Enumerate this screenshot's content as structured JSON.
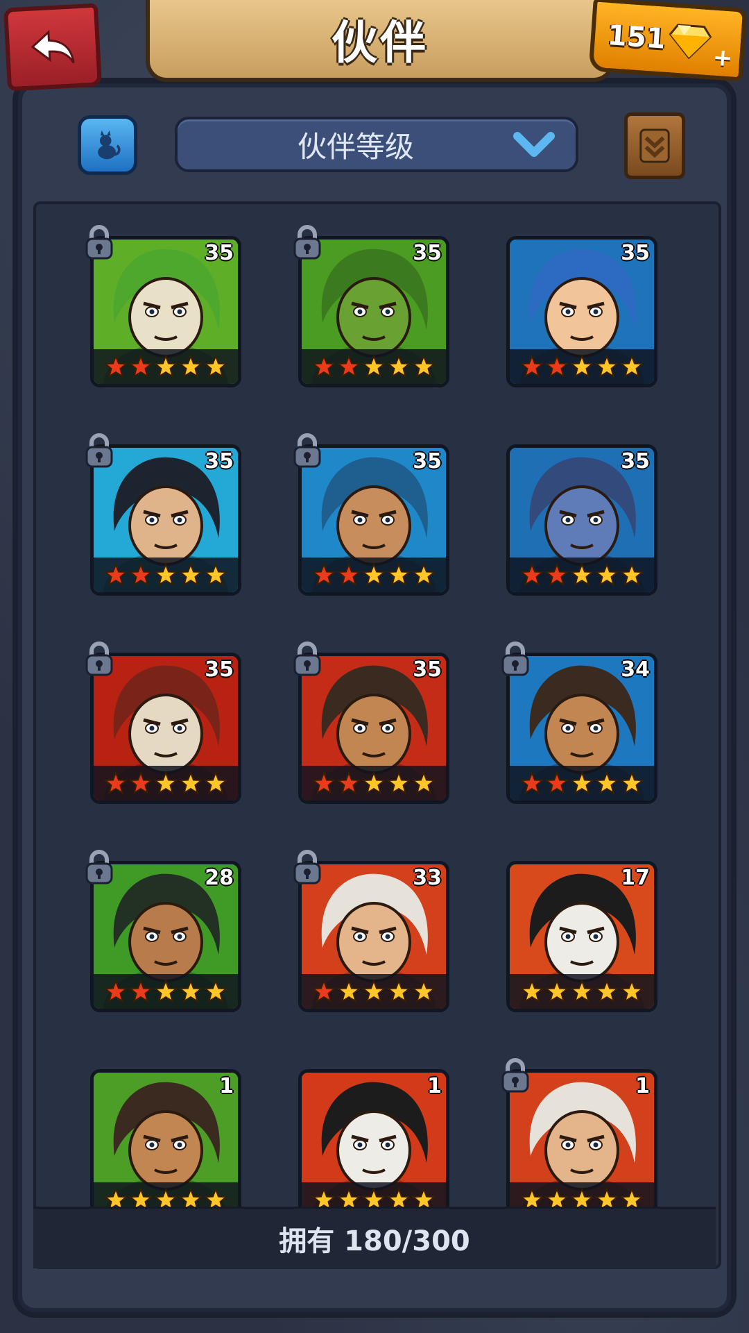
{
  "header": {
    "title": "伙伴",
    "gem_count": "151"
  },
  "toolbar": {
    "sort_label": "伙伴等级"
  },
  "heroes": [
    {
      "level": "35",
      "stars_red": 2,
      "bg": "#5fae28",
      "skin": "#e9e0c8",
      "hair": "#4fa82e",
      "locked": true
    },
    {
      "level": "35",
      "stars_red": 2,
      "bg": "#4a9c22",
      "skin": "#6aa133",
      "hair": "#3b7a1e",
      "locked": true
    },
    {
      "level": "35",
      "stars_red": 2,
      "bg": "#1f73b8",
      "skin": "#f2c49a",
      "hair": "#2d6bc2",
      "locked": false
    },
    {
      "level": "35",
      "stars_red": 2,
      "bg": "#24a8d6",
      "skin": "#e0b48b",
      "hair": "#1c2430",
      "locked": true
    },
    {
      "level": "35",
      "stars_red": 2,
      "bg": "#1e88c8",
      "skin": "#c88d5c",
      "hair": "#1f5f8f",
      "locked": true
    },
    {
      "level": "35",
      "stars_red": 2,
      "bg": "#1e6fb4",
      "skin": "#5f7bb8",
      "hair": "#324a7c",
      "locked": false
    },
    {
      "level": "35",
      "stars_red": 2,
      "bg": "#b82212",
      "skin": "#e6d9c4",
      "hair": "#7a2318",
      "locked": true
    },
    {
      "level": "35",
      "stars_red": 2,
      "bg": "#c52c18",
      "skin": "#c28652",
      "hair": "#3a2a20",
      "locked": true
    },
    {
      "level": "34",
      "stars_red": 2,
      "bg": "#1d78c0",
      "skin": "#c28652",
      "hair": "#3a2a20",
      "locked": true
    },
    {
      "level": "28",
      "stars_red": 2,
      "bg": "#3f9a26",
      "skin": "#b87c4c",
      "hair": "#233024",
      "locked": true
    },
    {
      "level": "33",
      "stars_red": 1,
      "bg": "#d3401c",
      "skin": "#e4b48a",
      "hair": "#e6e2da",
      "locked": true
    },
    {
      "level": "17",
      "stars_red": 0,
      "bg": "#d84a1c",
      "skin": "#eeece6",
      "hair": "#1c1c1c",
      "locked": false
    },
    {
      "level": "1",
      "stars_red": 0,
      "bg": "#4c9e26",
      "skin": "#c28652",
      "hair": "#3a2a20",
      "locked": false
    },
    {
      "level": "1",
      "stars_red": 0,
      "bg": "#d23a1a",
      "skin": "#eeece6",
      "hair": "#1c1c1c",
      "locked": false
    },
    {
      "level": "1",
      "stars_red": 0,
      "bg": "#d3401c",
      "skin": "#e4b48a",
      "hair": "#e6e2da",
      "locked": true
    }
  ],
  "footer": {
    "owned_text": "拥有 180/300"
  },
  "colors": {
    "star_gold": "#ffc629",
    "star_red": "#ea3b1c",
    "frame": "#2b3244"
  }
}
